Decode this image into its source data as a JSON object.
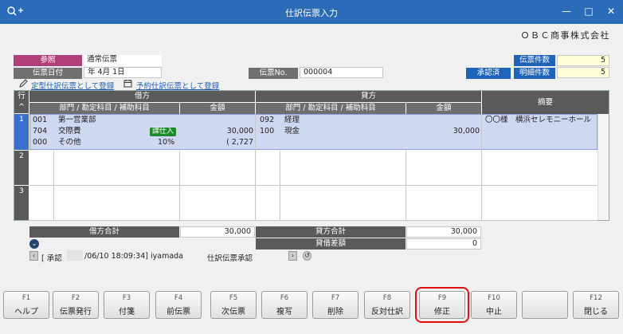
{
  "window": {
    "title": "仕訳伝票入力",
    "company": "ＯＢＣ商事株式会社"
  },
  "header": {
    "ref_label": "参照",
    "ref_value": "通常伝票",
    "date_label": "伝票日付",
    "date_value": "年  4月  1日",
    "voucher_no_label": "伝票No.",
    "voucher_no_value": "000004",
    "approved_label": "承認済",
    "count_label": "伝票件数",
    "count_value": "5",
    "detail_count_label": "明細件数",
    "detail_count_value": "5",
    "link1": "定型仕訳伝票として登録",
    "link2": "予約仕訳伝票として登録"
  },
  "grid": {
    "row_header": "行",
    "debit_header": "借方",
    "credit_header": "貸方",
    "account_header": "部門 / 勘定科目 / 補助科目",
    "amount_header": "金額",
    "memo_header": "摘要",
    "rows": [
      {
        "num": "1",
        "debit_dept_code": "001",
        "debit_dept": "第一営業部",
        "debit_acct_code": "704",
        "debit_acct": "交際費",
        "tax_badge": "課仕入",
        "debit_sub_code": "000",
        "debit_sub": "その他",
        "tax_rate": "10%",
        "debit_amount": "30,000",
        "debit_tax": "( 2,727",
        "credit_dept_code": "092",
        "credit_dept": "経理",
        "credit_acct_code": "100",
        "credit_acct": "現金",
        "credit_amount": "30,000",
        "memo": "〇〇様　横浜セレモニーホール"
      },
      {
        "num": "2"
      },
      {
        "num": "3"
      }
    ]
  },
  "totals": {
    "debit_total_label": "借方合計",
    "debit_total": "30,000",
    "credit_total_label": "貸方合計",
    "credit_total": "30,000",
    "diff_label": "貸借差額",
    "diff": "0"
  },
  "status": {
    "approval": "[ 承認",
    "approval_time": "/06/10 18:09:34]  iyamada",
    "approval_type": "仕訳伝票承認"
  },
  "fkeys": [
    {
      "key": "F1",
      "label": "ヘルプ"
    },
    {
      "key": "F2",
      "label": "伝票発行"
    },
    {
      "key": "F3",
      "label": "付箋"
    },
    {
      "key": "F4",
      "label": "前伝票"
    },
    {
      "key": "F5",
      "label": "次伝票"
    },
    {
      "key": "F6",
      "label": "複写"
    },
    {
      "key": "F7",
      "label": "削除"
    },
    {
      "key": "F8",
      "label": "反対仕訳"
    },
    {
      "key": "F9",
      "label": "修正"
    },
    {
      "key": "F10",
      "label": "中止"
    },
    {
      "key": "",
      "label": ""
    },
    {
      "key": "F12",
      "label": "閉じる"
    }
  ],
  "colors": {
    "titlebar": "#2b6cb8",
    "highlight": "#e01010",
    "selected_row": "#cfd8f1"
  }
}
